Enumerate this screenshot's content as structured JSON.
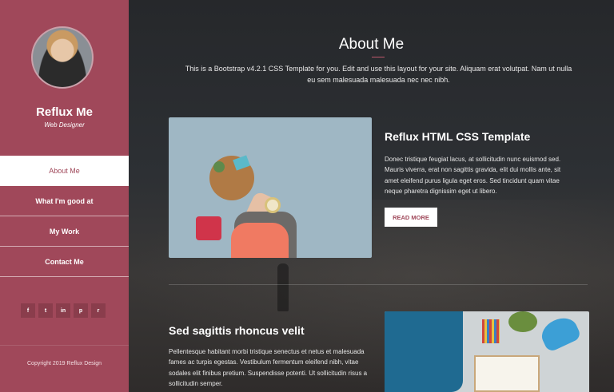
{
  "sidebar": {
    "name": "Reflux Me",
    "role": "Web Designer",
    "nav": [
      {
        "label": "About Me",
        "active": true
      },
      {
        "label": "What I'm good at",
        "active": false
      },
      {
        "label": "My Work",
        "active": false
      },
      {
        "label": "Contact Me",
        "active": false
      }
    ],
    "socials": [
      {
        "icon": "facebook-icon",
        "glyph": "f"
      },
      {
        "icon": "twitter-icon",
        "glyph": "t"
      },
      {
        "icon": "linkedin-icon",
        "glyph": "in"
      },
      {
        "icon": "pinterest-icon",
        "glyph": "p"
      },
      {
        "icon": "rss-icon",
        "glyph": "r"
      }
    ],
    "copyright": "Copyright 2019 Reflux Design"
  },
  "main": {
    "title": "About Me",
    "intro": "This is a Bootstrap v4.2.1 CSS Template for you. Edit and use this layout for your site. Aliquam erat volutpat. Nam ut nulla eu sem malesuada malesuada nec nec nibh.",
    "section1": {
      "heading": "Reflux HTML CSS Template",
      "body": "Donec tristique feugiat lacus, at sollicitudin nunc euismod sed. Mauris viverra, erat non sagittis gravida, elit dui mollis ante, sit amet eleifend purus ligula eget eros. Sed tincidunt quam vitae neque pharetra dignissim eget ut libero.",
      "button": "READ MORE"
    },
    "section2": {
      "heading": "Sed sagittis rhoncus velit",
      "body": "Pellentesque habitant morbi tristique senectus et netus et malesuada fames ac turpis egestas. Vestibulum fermentum eleifend nibh, vitae sodales elit finibus pretium. Suspendisse potenti. Ut sollicitudin risus a sollicitudin semper."
    }
  },
  "colors": {
    "accent": "#a0485a",
    "background": "#2a2c2f"
  }
}
